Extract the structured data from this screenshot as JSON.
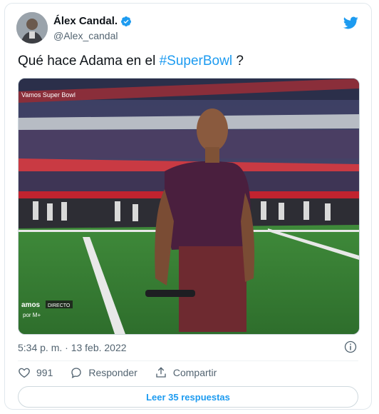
{
  "author": {
    "name": "Álex Candal.",
    "handle": "@Alex_candal",
    "verified_icon": "verified-badge-icon"
  },
  "tweet": {
    "text_prefix": "Qué hace Adama en el ",
    "hashtag": "#SuperBowl",
    "text_suffix": " ?",
    "timestamp": "5:34 p. m. · 13 feb. 2022"
  },
  "media": {
    "overlay_text_top": "Vamos Super Bowl",
    "overlay_brand": "amos",
    "overlay_directo": "DIRECTO",
    "overlay_logo": "por M+"
  },
  "actions": {
    "likes_count": "991",
    "reply_label": "Responder",
    "share_label": "Compartir"
  },
  "replies_button": {
    "label": "Leer 35 respuestas"
  },
  "colors": {
    "accent": "#1d9bf0",
    "text_primary": "#0f1419",
    "text_secondary": "#536471"
  }
}
